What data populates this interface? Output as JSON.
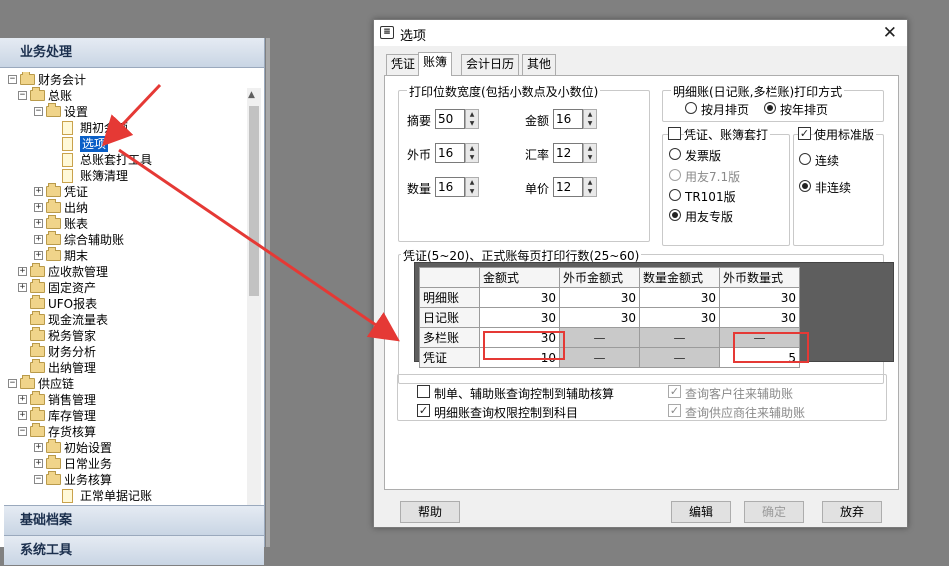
{
  "nav": {
    "header": "业务处理",
    "section_bottom_1": "基础档案",
    "section_bottom_2": "系统工具",
    "tree": [
      {
        "label": "财务会计",
        "level": 0,
        "kind": "folder",
        "exp": "−"
      },
      {
        "label": "总账",
        "level": 1,
        "kind": "folder",
        "exp": "−"
      },
      {
        "label": "设置",
        "level": 2,
        "kind": "folder",
        "exp": "−"
      },
      {
        "label": "期初余额",
        "level": 3,
        "kind": "doc"
      },
      {
        "label": "选项",
        "level": 3,
        "kind": "doc",
        "selected": true
      },
      {
        "label": "总账套打工具",
        "level": 3,
        "kind": "doc"
      },
      {
        "label": "账簿清理",
        "level": 3,
        "kind": "doc"
      },
      {
        "label": "凭证",
        "level": 2,
        "kind": "folder",
        "exp": "+"
      },
      {
        "label": "出纳",
        "level": 2,
        "kind": "folder",
        "exp": "+"
      },
      {
        "label": "账表",
        "level": 2,
        "kind": "folder",
        "exp": "+"
      },
      {
        "label": "综合辅助账",
        "level": 2,
        "kind": "folder",
        "exp": "+"
      },
      {
        "label": "期末",
        "level": 2,
        "kind": "folder",
        "exp": "+"
      },
      {
        "label": "应收款管理",
        "level": 1,
        "kind": "folder",
        "exp": "+"
      },
      {
        "label": "固定资产",
        "level": 1,
        "kind": "folder",
        "exp": "+"
      },
      {
        "label": "UFO报表",
        "level": 1,
        "kind": "folder"
      },
      {
        "label": "现金流量表",
        "level": 1,
        "kind": "folder"
      },
      {
        "label": "税务管家",
        "level": 1,
        "kind": "folder"
      },
      {
        "label": "财务分析",
        "level": 1,
        "kind": "folder"
      },
      {
        "label": "出纳管理",
        "level": 1,
        "kind": "folder"
      },
      {
        "label": "供应链",
        "level": 0,
        "kind": "folder",
        "exp": "−"
      },
      {
        "label": "销售管理",
        "level": 1,
        "kind": "folder",
        "exp": "+"
      },
      {
        "label": "库存管理",
        "level": 1,
        "kind": "folder",
        "exp": "+"
      },
      {
        "label": "存货核算",
        "level": 1,
        "kind": "folder",
        "exp": "−"
      },
      {
        "label": "初始设置",
        "level": 2,
        "kind": "folder",
        "exp": "+"
      },
      {
        "label": "日常业务",
        "level": 2,
        "kind": "folder",
        "exp": "+"
      },
      {
        "label": "业务核算",
        "level": 2,
        "kind": "folder",
        "exp": "−"
      },
      {
        "label": "正常单据记账",
        "level": 3,
        "kind": "doc"
      }
    ]
  },
  "dialog": {
    "title": "选项",
    "tabs": [
      "凭证",
      "账簿",
      "会计日历",
      "其他"
    ],
    "active_tab": "账簿",
    "print_width": {
      "title": "打印位数宽度(包括小数点及小数位)",
      "summary_label": "摘要",
      "summary_value": "50",
      "amount_label": "金额",
      "amount_value": "16",
      "fx_label": "外币",
      "fx_value": "16",
      "rate_label": "汇率",
      "rate_value": "12",
      "qty_label": "数量",
      "qty_value": "16",
      "price_label": "单价",
      "price_value": "12"
    },
    "print_mode": {
      "title": "明细账(日记账,多栏账)打印方式",
      "by_month": "按月排页",
      "by_year": "按年排页",
      "selected": "按年排页"
    },
    "voucher_print": {
      "check_label": "凭证、账簿套打",
      "options": [
        "发票版",
        "用友7.1版",
        "TR101版",
        "用友专版"
      ],
      "selected": "用友专版"
    },
    "standard_version": {
      "check_label": "使用标准版",
      "options": [
        "连续",
        "非连续"
      ],
      "selected": "非连续"
    },
    "rows_per_page": {
      "title": "凭证(5~20)、正式账每页打印行数(25~60)",
      "columns": [
        "",
        "金额式",
        "外币金额式",
        "数量金额式",
        "外币数量式"
      ],
      "rows": [
        {
          "name": "明细账",
          "cells": [
            "30",
            "30",
            "30",
            "30"
          ]
        },
        {
          "name": "日记账",
          "cells": [
            "30",
            "30",
            "30",
            "30"
          ]
        },
        {
          "name": "多栏账",
          "cells": [
            "30",
            "—",
            "—",
            "—"
          ]
        },
        {
          "name": "凭证",
          "cells": [
            "10",
            "—",
            "—",
            "5"
          ]
        }
      ]
    },
    "options": {
      "ctrl_aux": "制单、辅助账查询控制到辅助核算",
      "ctrl_detail": "明细账查询权限控制到科目",
      "query_customer": "查询客户往来辅助账",
      "query_supplier": "查询供应商往来辅助账"
    },
    "buttons": {
      "help": "帮助",
      "edit": "编辑",
      "ok": "确定",
      "cancel": "放弃"
    }
  },
  "colors": {
    "annotation_red": "#e53935",
    "selection_blue": "#0a5fc7"
  }
}
